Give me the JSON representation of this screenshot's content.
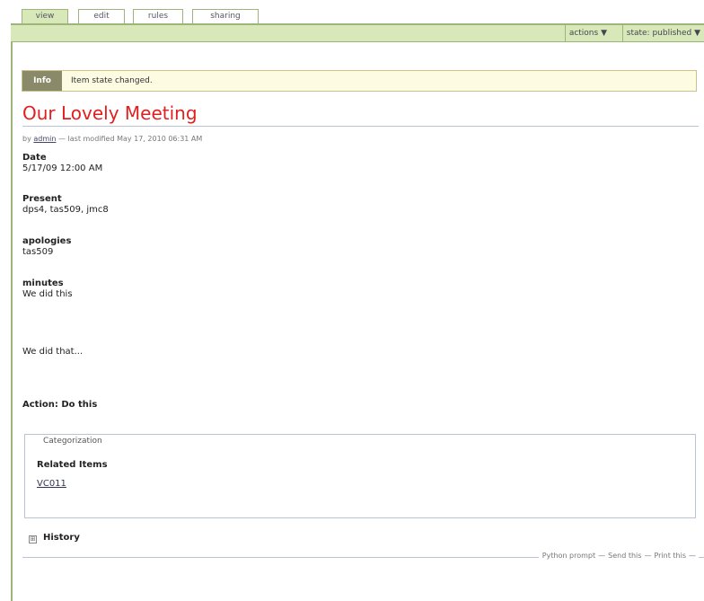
{
  "tabs": [
    "view",
    "edit",
    "rules",
    "sharing"
  ],
  "actionbar": {
    "actions_label": "actions ▼",
    "state_label": "state: published ▼"
  },
  "message": {
    "tag": "Info",
    "text": "Item state changed."
  },
  "document": {
    "title": "Our Lovely Meeting",
    "byline_prefix": "by",
    "author": "admin",
    "byline_suffix": "— last modified May 17, 2010 06:31 AM",
    "fields": [
      {
        "label": "Date",
        "value": "5/17/09 12:00 AM"
      },
      {
        "label": "Present",
        "value": "dps4, tas509, jmc8"
      },
      {
        "label": "apologies",
        "value": "tas509"
      },
      {
        "label": "minutes",
        "value": "We did this"
      }
    ],
    "minutes_more": "We did that...",
    "action_line": "Action: Do this"
  },
  "categorization": {
    "legend": "Categorization",
    "related_label": "Related Items",
    "related_link": "VC011"
  },
  "history": {
    "icon": "⊞",
    "label": "History"
  },
  "document_actions": [
    "Python prompt",
    "Send this",
    "Print this"
  ]
}
